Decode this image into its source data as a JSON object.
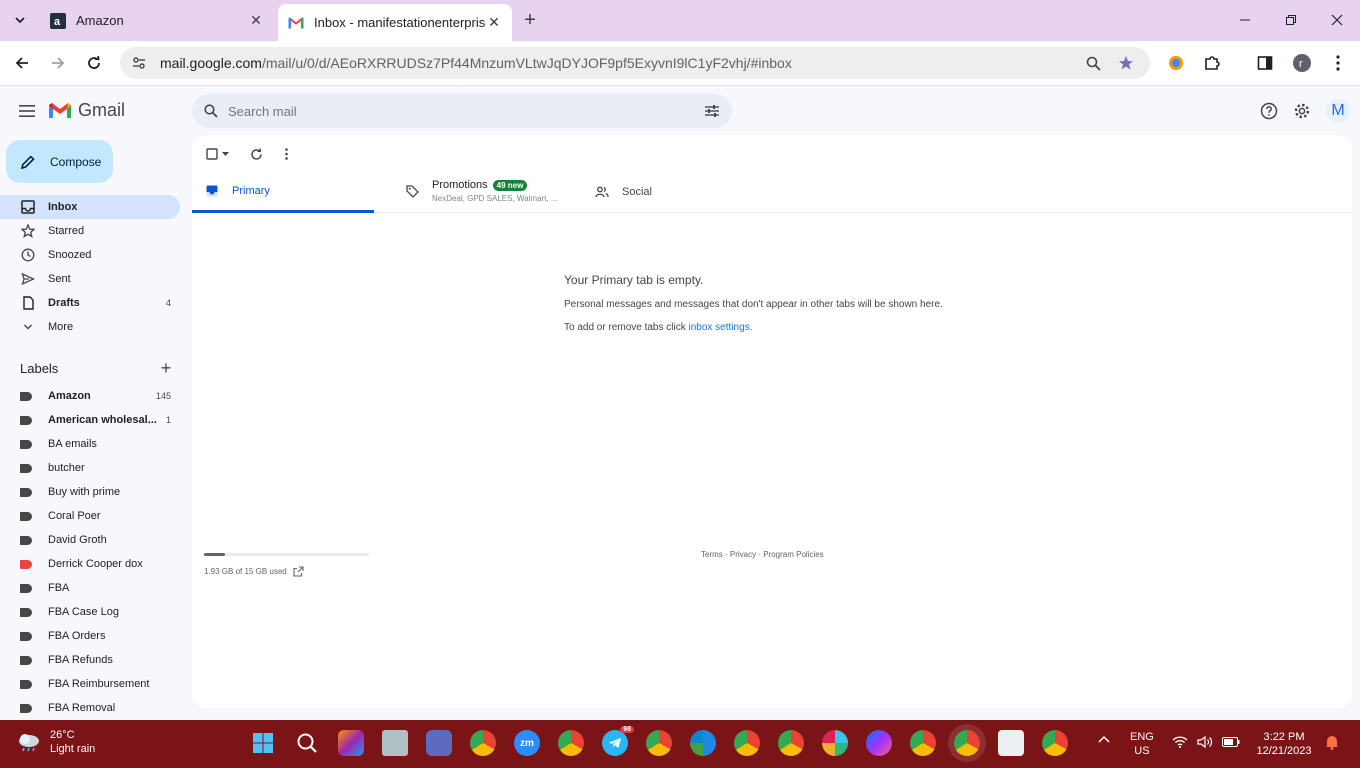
{
  "browser": {
    "tabs": [
      {
        "title": "Amazon",
        "favicon": "amazon-icon"
      },
      {
        "title": "Inbox - manifestationenterprise",
        "favicon": "gmail-icon"
      }
    ],
    "url_host": "mail.google.com",
    "url_path": "/mail/u/0/d/AEoRXRRUDSz7Pf44MnzumVLtwJqDYJOF9pf5ExyvnI9lC1yF2vhj/#inbox"
  },
  "gmail": {
    "brand": "Gmail",
    "search_placeholder": "Search mail",
    "avatar_letter": "M",
    "compose_label": "Compose",
    "nav": [
      {
        "label": "Inbox",
        "count": "",
        "icon": "inbox-icon"
      },
      {
        "label": "Starred",
        "count": "",
        "icon": "star-icon"
      },
      {
        "label": "Snoozed",
        "count": "",
        "icon": "clock-icon"
      },
      {
        "label": "Sent",
        "count": "",
        "icon": "send-icon"
      },
      {
        "label": "Drafts",
        "count": "4",
        "icon": "draft-icon"
      },
      {
        "label": "More",
        "count": "",
        "icon": "chevron-down-icon"
      }
    ],
    "labels_title": "Labels",
    "labels": [
      {
        "label": "Amazon",
        "count": "145"
      },
      {
        "label": "American wholesal...",
        "count": "1"
      },
      {
        "label": "BA emails",
        "count": ""
      },
      {
        "label": "butcher",
        "count": ""
      },
      {
        "label": "Buy with prime",
        "count": ""
      },
      {
        "label": "Coral Poer",
        "count": ""
      },
      {
        "label": "David Groth",
        "count": ""
      },
      {
        "label": "Derrick Cooper dox",
        "count": ""
      },
      {
        "label": "FBA",
        "count": ""
      },
      {
        "label": "FBA Case Log",
        "count": ""
      },
      {
        "label": "FBA Orders",
        "count": ""
      },
      {
        "label": "FBA Refunds",
        "count": ""
      },
      {
        "label": "FBA Reimbursement",
        "count": ""
      },
      {
        "label": "FBA Removal",
        "count": ""
      }
    ],
    "label_colors": {
      "default": "#444746",
      "derrick": "#e8453c"
    },
    "inbox_tabs": {
      "primary": "Primary",
      "promotions": "Promotions",
      "promotions_badge": "49 new",
      "promotions_senders": "NexDeal, GPD SALES, Walmart, ...",
      "social": "Social"
    },
    "empty": {
      "title": "Your Primary tab is empty.",
      "line1": "Personal messages and messages that don't appear in other tabs will be shown here.",
      "line2_prefix": "To add or remove tabs click ",
      "line2_link": "inbox settings",
      "line2_suffix": "."
    },
    "storage": {
      "text": "1.93 GB of 15 GB used",
      "used_fraction": 0.129
    },
    "footer": {
      "terms": "Terms",
      "privacy": "Privacy",
      "policies": "Program Policies",
      "sep": " · "
    }
  },
  "taskbar": {
    "temperature": "26°C",
    "condition": "Light rain",
    "language": "ENG",
    "region": "US",
    "time": "3:22 PM",
    "date": "12/21/2023",
    "telegram_badge": "98",
    "zoom_label": "zm"
  }
}
